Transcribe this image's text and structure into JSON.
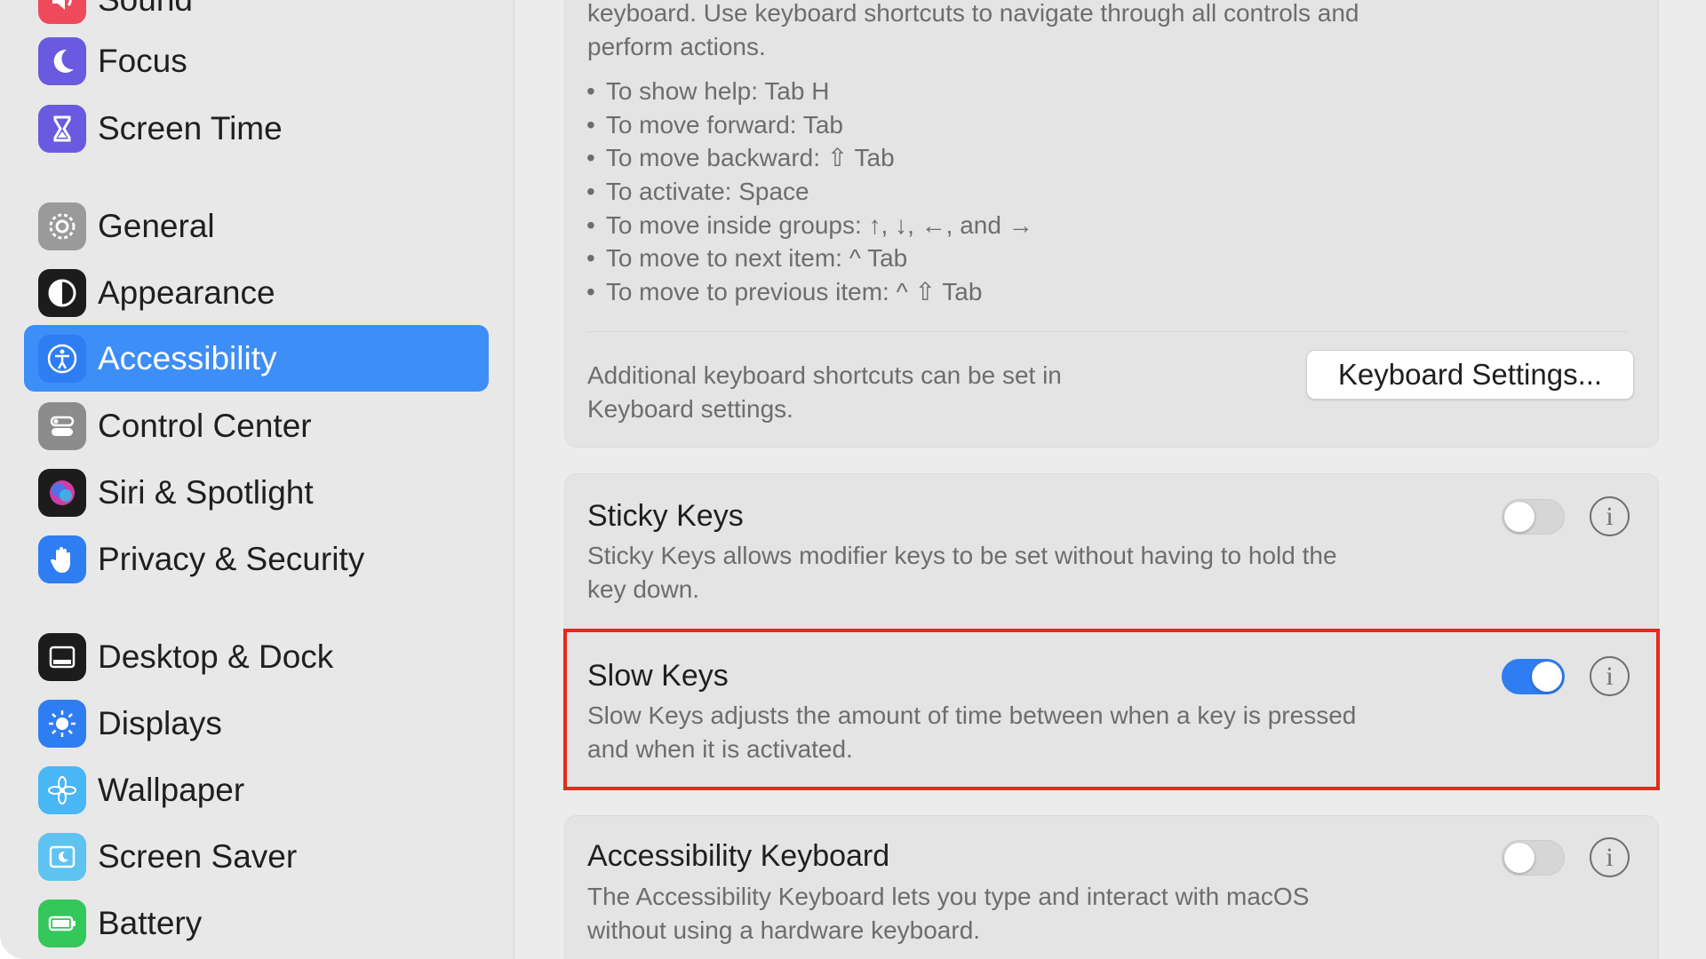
{
  "sidebar": {
    "items": [
      {
        "label": "Sound",
        "icon": "sound-icon",
        "color": "#ef4a5c"
      },
      {
        "label": "Focus",
        "icon": "moon-icon",
        "color": "#6a5ae0"
      },
      {
        "label": "Screen Time",
        "icon": "hourglass-icon",
        "color": "#6a5ae0"
      },
      {
        "label": "General",
        "icon": "gear-icon",
        "color": "#9a9a9a"
      },
      {
        "label": "Appearance",
        "icon": "appearance-icon",
        "color": "#1c1c1c"
      },
      {
        "label": "Accessibility",
        "icon": "accessibility-icon",
        "color": "#2f7df2",
        "selected": true
      },
      {
        "label": "Control Center",
        "icon": "control-center-icon",
        "color": "#8c8c8c"
      },
      {
        "label": "Siri & Spotlight",
        "icon": "siri-icon",
        "color": "#d03da8"
      },
      {
        "label": "Privacy & Security",
        "icon": "hand-icon",
        "color": "#2f7df2"
      },
      {
        "label": "Desktop & Dock",
        "icon": "dock-icon",
        "color": "#1c1c1c"
      },
      {
        "label": "Displays",
        "icon": "sun-icon",
        "color": "#2f7df2"
      },
      {
        "label": "Wallpaper",
        "icon": "flower-icon",
        "color": "#49b6f5"
      },
      {
        "label": "Screen Saver",
        "icon": "screen-saver-icon",
        "color": "#5ec3f0"
      },
      {
        "label": "Battery",
        "icon": "battery-icon",
        "color": "#34c759"
      }
    ]
  },
  "keyboard_nav": {
    "intro_line1": "keyboard. Use keyboard shortcuts to navigate through all controls and",
    "intro_line2": "perform actions.",
    "shortcuts": [
      "To show help: Tab H",
      "To move forward: Tab",
      "To move backward: ⇧ Tab",
      "To activate: Space",
      "To move inside groups: ↑, ↓, ←, and →",
      "To move to next item: ^ Tab",
      "To move to previous item: ^ ⇧ Tab"
    ],
    "additional_line1": "Additional keyboard shortcuts can be set in",
    "additional_line2": "Keyboard settings.",
    "button_label": "Keyboard Settings..."
  },
  "settings": {
    "sticky_keys": {
      "title": "Sticky Keys",
      "desc_line1": "Sticky Keys allows modifier keys to be set without having to hold the",
      "desc_line2": "key down.",
      "enabled": false
    },
    "slow_keys": {
      "title": "Slow Keys",
      "desc_line1": "Slow Keys adjusts the amount of time between when a key is pressed",
      "desc_line2": "and when it is activated.",
      "enabled": true
    },
    "accessibility_keyboard": {
      "title": "Accessibility Keyboard",
      "desc_line1": "The Accessibility Keyboard lets you type and interact with macOS",
      "desc_line2": "without using a hardware keyboard.",
      "enabled": false
    },
    "info_glyph": "i"
  },
  "colors": {
    "accent": "#3d8ef7",
    "highlight": "#e8281c"
  }
}
